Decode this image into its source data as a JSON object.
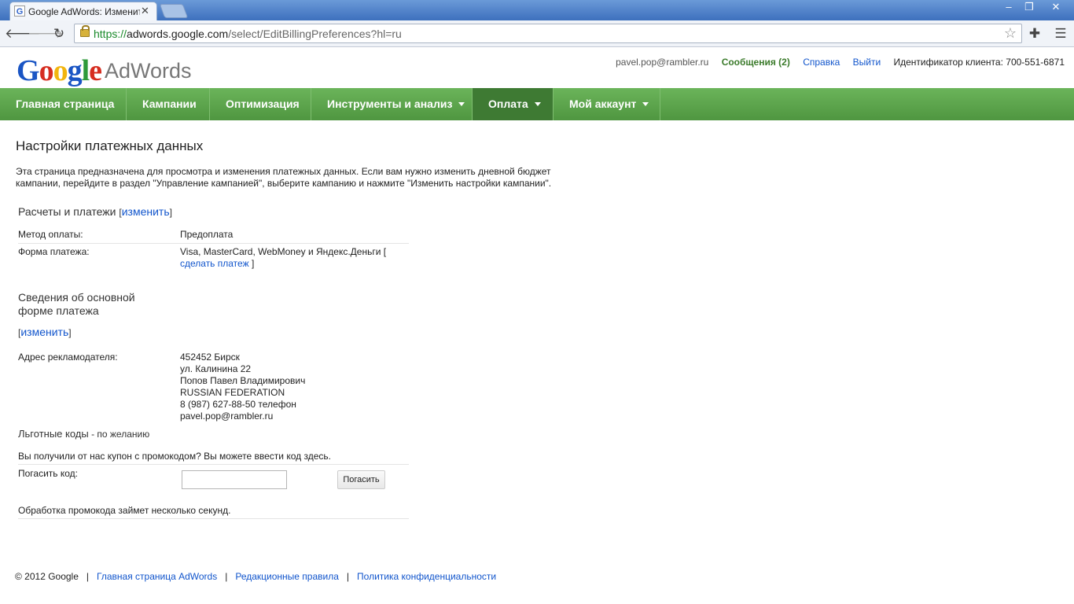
{
  "browser": {
    "tab_title": "Google AdWords: Изменить",
    "tab_close": "✕",
    "window_controls": [
      "‒",
      "❐",
      "✕"
    ],
    "url_scheme": "https://",
    "url_host": "adwords.google.com",
    "url_path": "/select/EditBillingPreferences?hl=ru",
    "back_icon": "🡐",
    "forward_icon": "🡒",
    "reload_icon": "↻",
    "star_icon": "☆",
    "extensions_icon": "✚",
    "menu_icon": "☰"
  },
  "header": {
    "logo_text": "Google",
    "logo_product": "AdWords",
    "email": "pavel.pop@rambler.ru",
    "messages": "Сообщения (2)",
    "help": "Справка",
    "logout": "Выйти",
    "client_id": "Идентификатор клиента: 700-551-6871"
  },
  "nav": {
    "items": [
      {
        "label": "Главная страница"
      },
      {
        "label": "Кампании"
      },
      {
        "label": "Оптимизация"
      },
      {
        "label": "Инструменты и анализ"
      },
      {
        "label": "Оплата"
      },
      {
        "label": "Мой аккаунт"
      }
    ]
  },
  "page": {
    "title": "Настройки платежных данных",
    "intro": "Эта страница предназначена для просмотра и изменения платежных данных. Если вам нужно изменить дневной бюджет кампании, перейдите в раздел \"Управление кампанией\", выберите кампанию и нажмите \"Изменить настройки кампании\".",
    "billing": {
      "title": "Расчеты и платежи",
      "bracket_open": "[",
      "bracket_close": "]",
      "edit_link": "изменить",
      "method_label": "Метод оплаты:",
      "method_value": "Предоплата",
      "form_label": "Форма платежа:",
      "form_value": "Visa, MasterCard, WebMoney и Яндекс.Деньги [",
      "make_payment_link": "сделать платеж",
      "form_close": "]"
    },
    "primary": {
      "title_line1": "Сведения об основной",
      "title_line2": "форме платежа",
      "edit_link": "изменить",
      "address_label": "Адрес рекламодателя:",
      "address_lines": [
        "452452 Бирск",
        "ул. Калинина 22",
        "Попов Павел Владимирович",
        "RUSSIAN FEDERATION",
        "8 (987) 627-88-50 телефон",
        "pavel.pop@rambler.ru"
      ]
    },
    "promo": {
      "title": "Льготные коды",
      "title_suffix": " - по желанию",
      "question": "Вы получили от нас купон с промокодом? Вы можете ввести код здесь.",
      "redeem_label": "Погасить код:",
      "input_value": "",
      "button": "Погасить",
      "note": "Обработка промокода займет несколько секунд."
    }
  },
  "footer": {
    "copyright": "© 2012 Google",
    "separator": "|",
    "links": [
      "Главная страница AdWords",
      "Редакционные правила",
      "Политика конфиденциальности"
    ]
  },
  "colors": {
    "nav_green": "#59a04a",
    "nav_active": "#3e7a33",
    "link_blue": "#1155cc",
    "messages_green": "#3a7a2a"
  }
}
